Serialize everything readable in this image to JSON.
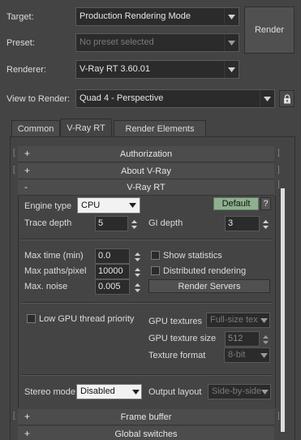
{
  "header": {
    "target_label": "Target:",
    "target_value": "Production Rendering Mode",
    "preset_label": "Preset:",
    "preset_value": "No preset selected",
    "renderer_label": "Renderer:",
    "renderer_value": "V-Ray RT 3.60.01",
    "view_label": "View to Render:",
    "view_value": "Quad 4 - Perspective",
    "render_button": "Render"
  },
  "tabs": [
    {
      "label": "Common"
    },
    {
      "label": "V-Ray RT"
    },
    {
      "label": "Render Elements"
    }
  ],
  "rollouts": {
    "authorization": {
      "sign": "+",
      "label": "Authorization"
    },
    "about": {
      "sign": "+",
      "label": "About V-Ray"
    },
    "vray_rt": {
      "sign": "-",
      "label": "V-Ray RT"
    },
    "frame_buffer": {
      "sign": "+",
      "label": "Frame buffer"
    },
    "global_switches": {
      "sign": "+",
      "label": "Global switches"
    }
  },
  "vray_rt": {
    "engine_type_label": "Engine type",
    "engine_type_value": "CPU",
    "default_button": "Default",
    "help_button": "?",
    "trace_depth_label": "Trace depth",
    "trace_depth_value": "5",
    "gi_depth_label": "GI depth",
    "gi_depth_value": "3",
    "max_time_label": "Max time (min)",
    "max_time_value": "0.0",
    "max_paths_label": "Max paths/pixel",
    "max_paths_value": "10000",
    "max_noise_label": "Max. noise",
    "max_noise_value": "0.005",
    "show_statistics_label": "Show statistics",
    "distributed_rendering_label": "Distributed rendering",
    "render_servers_button": "Render Servers",
    "low_gpu_label": "Low GPU thread priority",
    "gpu_textures_label": "GPU textures",
    "gpu_textures_value": "Full-size tex",
    "gpu_texture_size_label": "GPU texture size",
    "gpu_texture_size_value": "512",
    "texture_format_label": "Texture format",
    "texture_format_value": "8-bit",
    "stereo_mode_label": "Stereo mode",
    "stereo_mode_value": "Disabled",
    "output_layout_label": "Output layout",
    "output_layout_value": "Side-by-side"
  },
  "icons": {
    "lock": "lock-icon",
    "dropdown": "chevron-down-icon",
    "spinner": "spinner-arrows-icon"
  },
  "colors": {
    "background": "#444444",
    "field": "#2b2b2b",
    "default_button": "#8fb08f"
  }
}
